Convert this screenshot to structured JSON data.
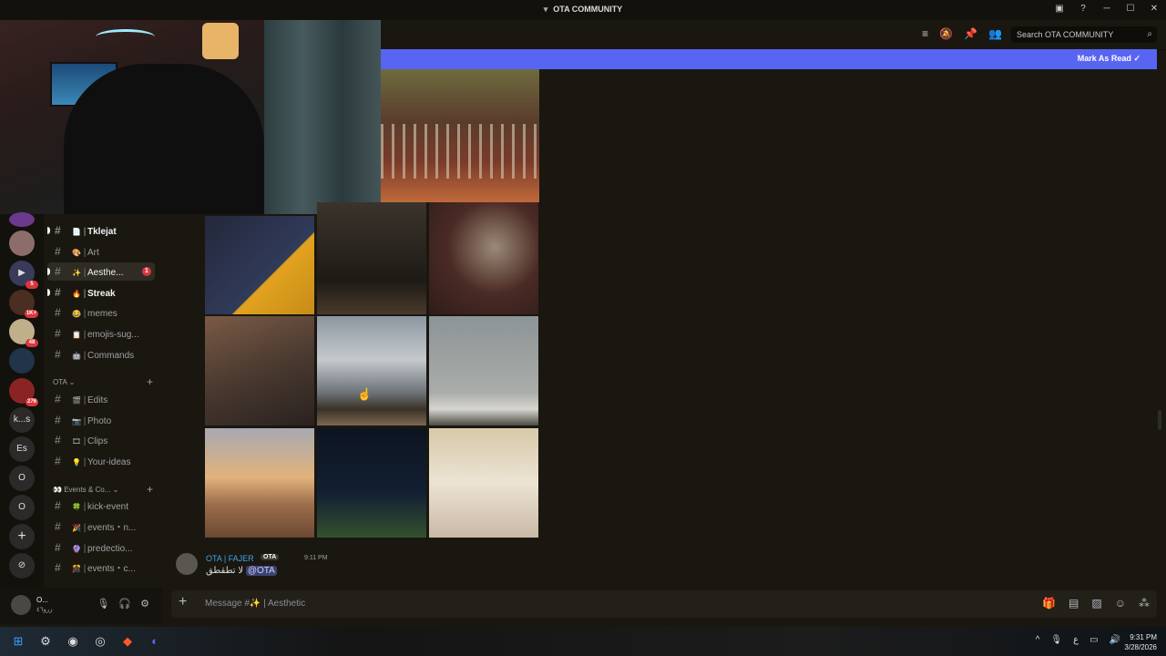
{
  "window": {
    "title": "OTA COMMUNITY"
  },
  "header": {
    "search_placeholder": "Search OTA COMMUNITY"
  },
  "banner": {
    "mark_read": "Mark As Read"
  },
  "servers": [
    {
      "label": "",
      "badge": ""
    },
    {
      "label": "",
      "badge": ""
    },
    {
      "label": "",
      "badge": "5"
    },
    {
      "label": "",
      "badge": "1K+"
    },
    {
      "label": "",
      "badge": "48"
    },
    {
      "label": "",
      "badge": ""
    },
    {
      "label": "",
      "badge": "276"
    },
    {
      "label": "k...s",
      "badge": ""
    },
    {
      "label": "Es",
      "badge": ""
    },
    {
      "label": "O",
      "badge": ""
    },
    {
      "label": "O",
      "badge": ""
    },
    {
      "label": "+",
      "badge": ""
    },
    {
      "label": "⊘",
      "badge": ""
    }
  ],
  "channels_top": [
    {
      "emoji": "📄",
      "name": "Tklejat",
      "badge": ""
    },
    {
      "emoji": "🎨",
      "name": "Art",
      "badge": ""
    },
    {
      "emoji": "✨",
      "name": "Aesthe...",
      "badge": "1"
    },
    {
      "emoji": "🔥",
      "name": "Streak",
      "badge": ""
    },
    {
      "emoji": "😂",
      "name": "memes",
      "badge": ""
    },
    {
      "emoji": "📋",
      "name": "emojis-sug...",
      "badge": ""
    },
    {
      "emoji": "🤖",
      "name": "Commands",
      "badge": ""
    }
  ],
  "category_ota": {
    "label": "OTA"
  },
  "channels_ota": [
    {
      "emoji": "🎬",
      "name": "Edits"
    },
    {
      "emoji": "📷",
      "name": "Photo"
    },
    {
      "emoji": "🎞",
      "name": "Clips"
    },
    {
      "emoji": "💡",
      "name": "Your-ideas"
    }
  ],
  "category_events": {
    "label": "Events & Co..."
  },
  "channels_events": [
    {
      "emoji": "🍀",
      "name": "kick-event"
    },
    {
      "emoji": "🎉",
      "name": "events・n..."
    },
    {
      "emoji": "🔮",
      "name": "predectio..."
    },
    {
      "emoji": "🎊",
      "name": "events・c..."
    }
  ],
  "message": {
    "author": "OTA | FAJER",
    "tag": "OTA",
    "time": "9:11 PM",
    "text": "لا تطقطق",
    "mention": "@OTA"
  },
  "composer": {
    "placeholder": "Message #✨ | Aesthetic"
  },
  "user": {
    "name": "O...",
    "status": "زرو٤٦"
  },
  "clock": {
    "time": "9:31 PM",
    "date": "3/28/2026"
  },
  "tray": {
    "lang": "ع"
  },
  "colors": {
    "accent": "#5865f2",
    "badge": "#da373c"
  }
}
